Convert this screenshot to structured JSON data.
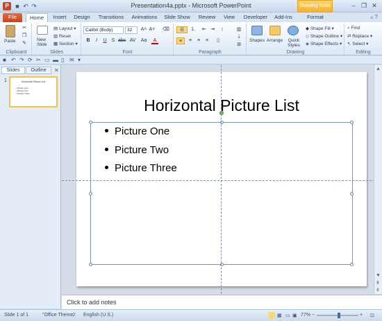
{
  "window": {
    "title": "Presentation4a.pptx - Microsoft PowerPoint",
    "contextual_tab": "Drawing Tools"
  },
  "tabs": [
    "File",
    "Home",
    "Insert",
    "Design",
    "Transitions",
    "Animations",
    "Slide Show",
    "Review",
    "View",
    "Developer",
    "Add-Ins",
    "Format"
  ],
  "ribbon": {
    "groups": {
      "clipboard": "Clipboard",
      "slides": "Slides",
      "font": "Font",
      "paragraph": "Paragraph",
      "drawing": "Drawing",
      "editing": "Editing"
    },
    "paste": "Paste",
    "new_slide": "New Slide",
    "layout": "Layout",
    "reset": "Reset",
    "section": "Section",
    "font_name": "Calibri (Body)",
    "font_size": "32",
    "shapes": "Shapes",
    "arrange": "Arrange",
    "quick_styles": "Quick Styles",
    "shape_fill": "Shape Fill",
    "shape_outline": "Shape Outline",
    "shape_effects": "Shape Effects",
    "find": "Find",
    "replace": "Replace",
    "select": "Select"
  },
  "pane": {
    "tab_slides": "Slides",
    "tab_outline": "Outline",
    "thumb_number": "1"
  },
  "slide": {
    "title": "Horizontal Picture List",
    "bullets": [
      "Picture One",
      "Picture Two",
      "Picture Three"
    ]
  },
  "notes": {
    "placeholder": "Click to add notes"
  },
  "status": {
    "slide": "Slide 1 of 1",
    "theme": "\"Office Theme\"",
    "language": "English (U.S.)",
    "zoom": "77%"
  },
  "colors": {
    "file_tab": "#c4451d",
    "contextual": "#f3b22d",
    "ribbon_bg": "#dce7f5",
    "selection_border": "#7a94b6"
  }
}
